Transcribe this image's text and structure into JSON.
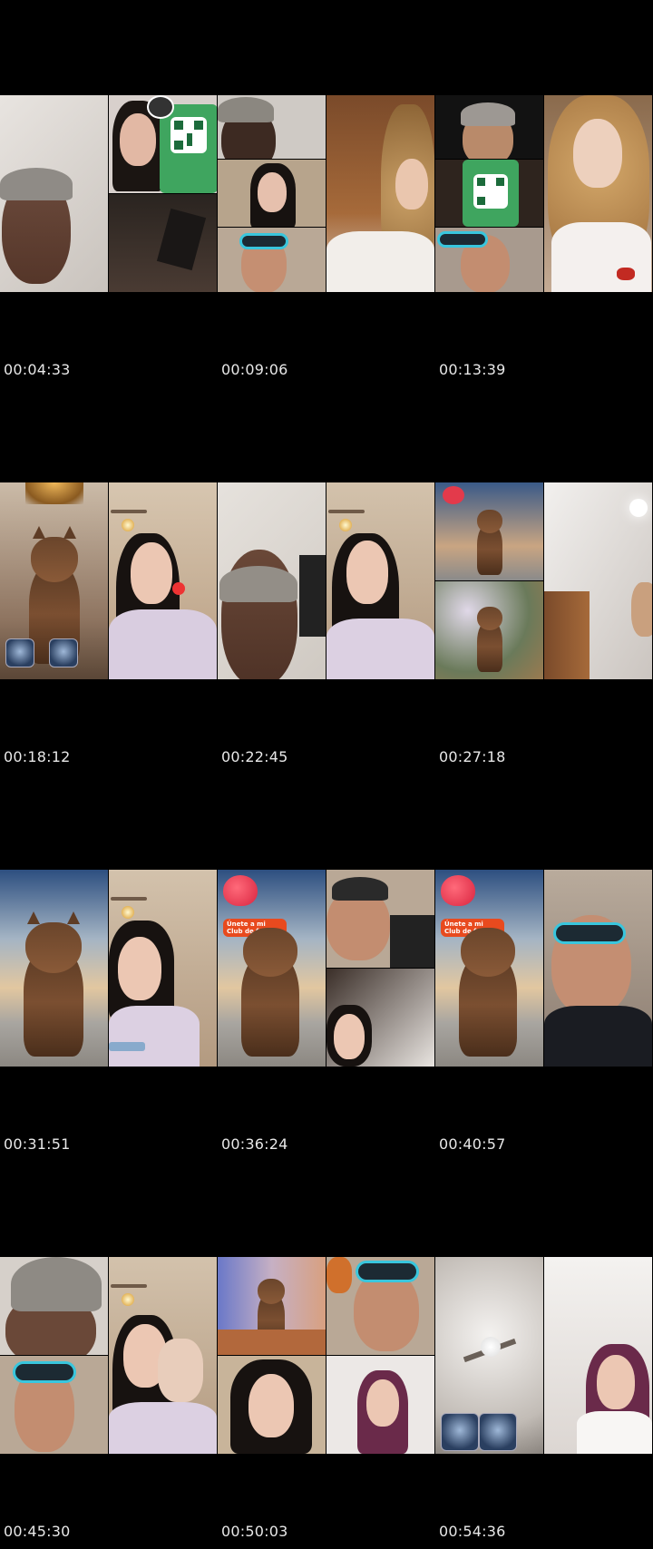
{
  "timestamps": [
    "00:04:33",
    "00:09:06",
    "00:13:39",
    "00:18:12",
    "00:22:45",
    "00:27:18",
    "00:31:51",
    "00:36:24",
    "00:40:57",
    "00:45:30",
    "00:50:03",
    "00:54:36"
  ],
  "fanclub_label": "Únete a mi Club de fans",
  "colors": {
    "background": "#000000",
    "timestamp_text": "#e8e8e8",
    "goggle_accent": "#39c6dd",
    "qr_green": "#3fa55f"
  }
}
